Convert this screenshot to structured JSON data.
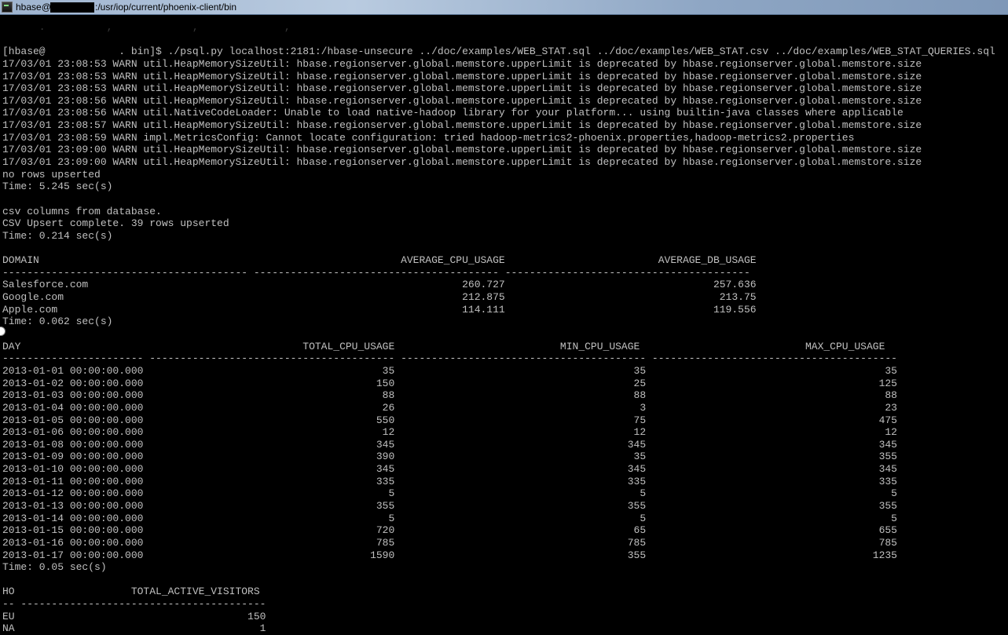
{
  "window": {
    "user_prefix": "hbase@",
    "path": ":/usr/iop/current/phoenix-client/bin"
  },
  "terminal_lines": [
    "      .          ,             ,              ,",
    "",
    "[hbase@            . bin]$ ./psql.py localhost:2181:/hbase-unsecure ../doc/examples/WEB_STAT.sql ../doc/examples/WEB_STAT.csv ../doc/examples/WEB_STAT_QUERIES.sql",
    "17/03/01 23:08:53 WARN util.HeapMemorySizeUtil: hbase.regionserver.global.memstore.upperLimit is deprecated by hbase.regionserver.global.memstore.size",
    "17/03/01 23:08:53 WARN util.HeapMemorySizeUtil: hbase.regionserver.global.memstore.upperLimit is deprecated by hbase.regionserver.global.memstore.size",
    "17/03/01 23:08:53 WARN util.HeapMemorySizeUtil: hbase.regionserver.global.memstore.upperLimit is deprecated by hbase.regionserver.global.memstore.size",
    "17/03/01 23:08:56 WARN util.HeapMemorySizeUtil: hbase.regionserver.global.memstore.upperLimit is deprecated by hbase.regionserver.global.memstore.size",
    "17/03/01 23:08:56 WARN util.NativeCodeLoader: Unable to load native-hadoop library for your platform... using builtin-java classes where applicable",
    "17/03/01 23:08:57 WARN util.HeapMemorySizeUtil: hbase.regionserver.global.memstore.upperLimit is deprecated by hbase.regionserver.global.memstore.size",
    "17/03/01 23:08:59 WARN impl.MetricsConfig: Cannot locate configuration: tried hadoop-metrics2-phoenix.properties,hadoop-metrics2.properties",
    "17/03/01 23:09:00 WARN util.HeapMemorySizeUtil: hbase.regionserver.global.memstore.upperLimit is deprecated by hbase.regionserver.global.memstore.size",
    "17/03/01 23:09:00 WARN util.HeapMemorySizeUtil: hbase.regionserver.global.memstore.upperLimit is deprecated by hbase.regionserver.global.memstore.size",
    "no rows upserted",
    "Time: 5.245 sec(s)",
    "",
    "csv columns from database.",
    "CSV Upsert complete. 39 rows upserted",
    "Time: 0.214 sec(s)",
    "",
    "DOMAIN                                                           AVERAGE_CPU_USAGE                         AVERAGE_DB_USAGE",
    "---------------------------------------- ---------------------------------------- ----------------------------------------",
    "Salesforce.com                                                             260.727                                  257.636",
    "Google.com                                                                 212.875                                   213.75",
    "Apple.com                                                                  114.111                                  119.556",
    "Time: 0.062 sec(s)",
    "",
    "DAY                                              TOTAL_CPU_USAGE                           MIN_CPU_USAGE                           MAX_CPU_USAGE",
    "----------------------- ---------------------------------------- ---------------------------------------- ----------------------------------------",
    "2013-01-01 00:00:00.000                                       35                                       35                                       35",
    "2013-01-02 00:00:00.000                                      150                                       25                                      125",
    "2013-01-03 00:00:00.000                                       88                                       88                                       88",
    "2013-01-04 00:00:00.000                                       26                                        3                                       23",
    "2013-01-05 00:00:00.000                                      550                                       75                                      475",
    "2013-01-06 00:00:00.000                                       12                                       12                                       12",
    "2013-01-08 00:00:00.000                                      345                                      345                                      345",
    "2013-01-09 00:00:00.000                                      390                                       35                                      355",
    "2013-01-10 00:00:00.000                                      345                                      345                                      345",
    "2013-01-11 00:00:00.000                                      335                                      335                                      335",
    "2013-01-12 00:00:00.000                                        5                                        5                                        5",
    "2013-01-13 00:00:00.000                                      355                                      355                                      355",
    "2013-01-14 00:00:00.000                                        5                                        5                                        5",
    "2013-01-15 00:00:00.000                                      720                                       65                                      655",
    "2013-01-16 00:00:00.000                                      785                                      785                                      785",
    "2013-01-17 00:00:00.000                                     1590                                      355                                     1235",
    "Time: 0.05 sec(s)",
    "",
    "HO                   TOTAL_ACTIVE_VISITORS",
    "-- ----------------------------------------",
    "EU                                      150",
    "NA                                        1"
  ]
}
